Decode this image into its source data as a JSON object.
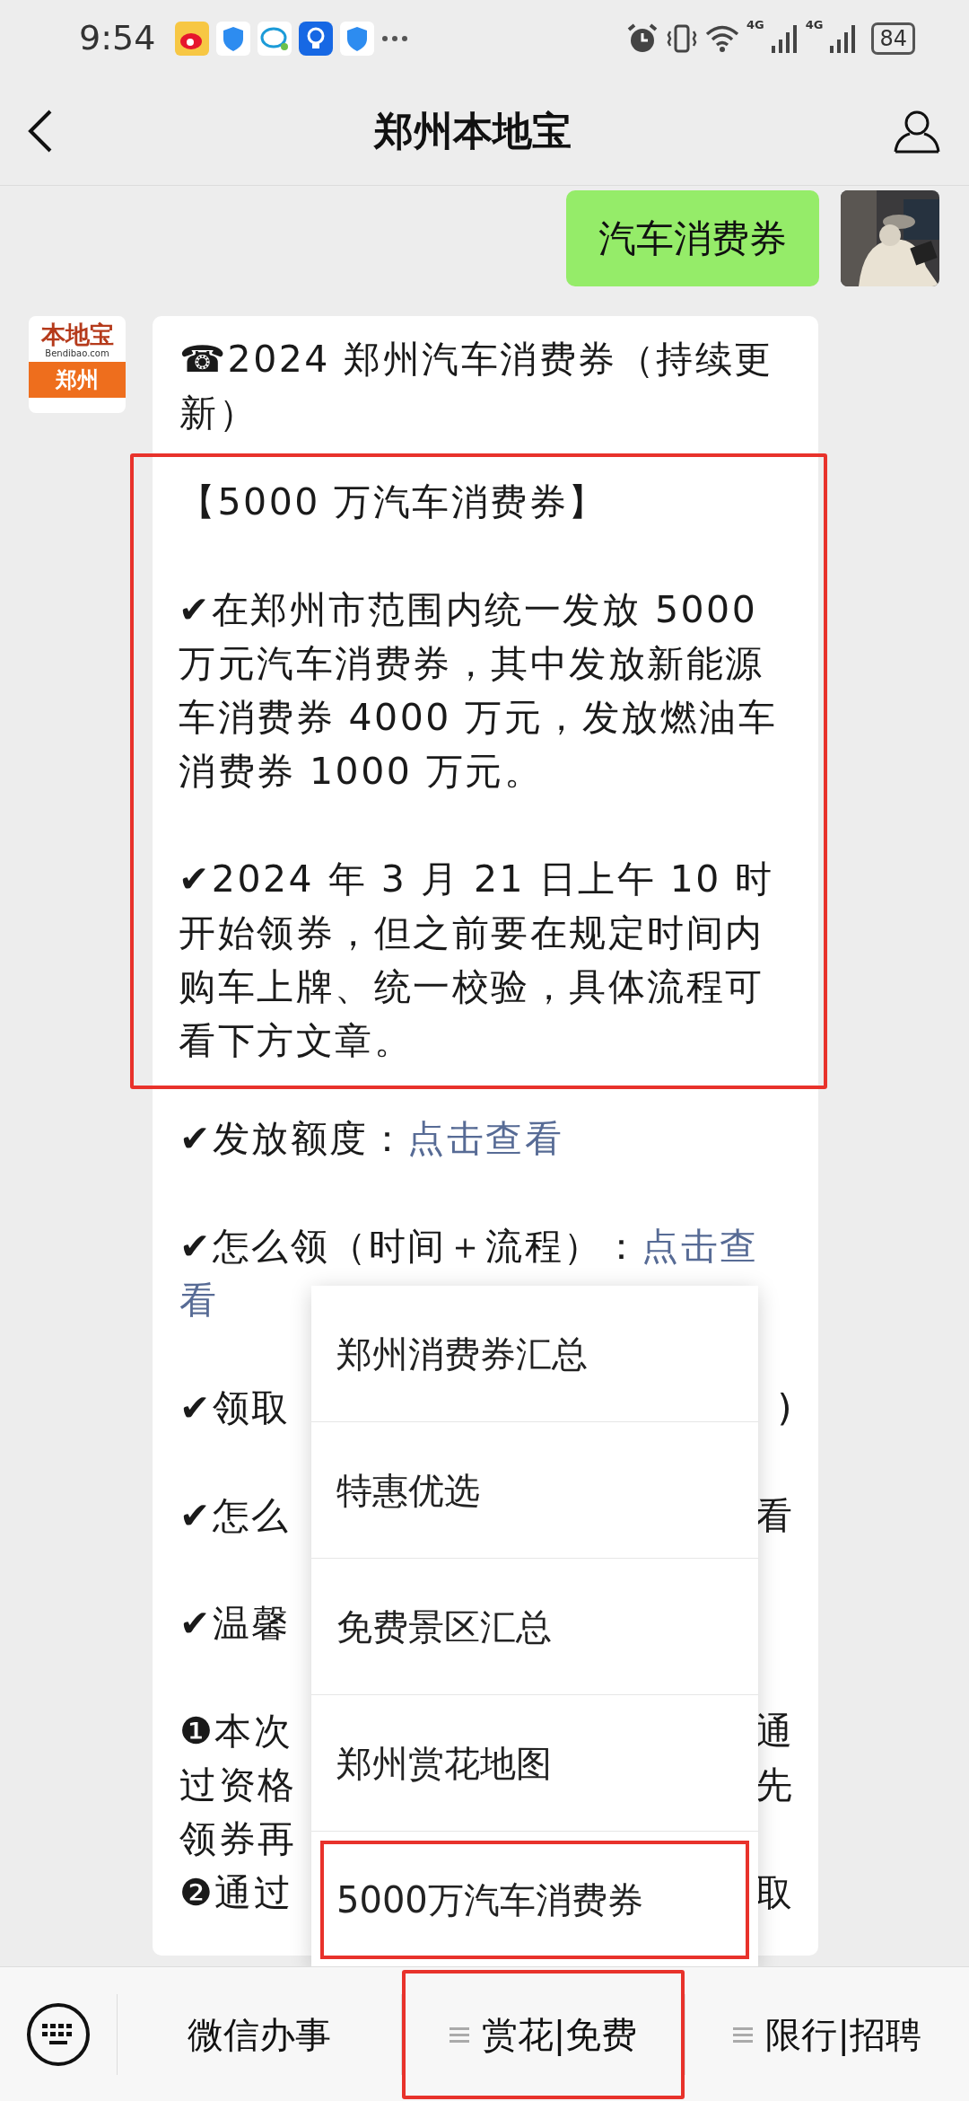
{
  "status_bar": {
    "time": "9:54",
    "network": [
      "4G",
      "4G"
    ],
    "battery": "84"
  },
  "header": {
    "title": "郑州本地宝"
  },
  "sent": {
    "text": "汽车消费券"
  },
  "received": {
    "avatar_lines": [
      "本地宝",
      "Bendibao.com",
      "郑州"
    ],
    "title": "☎2024 郑州汽车消费券（持续更新）",
    "highlight": {
      "framed": true,
      "heading": "【5000 万汽车消费券】",
      "paragraphs": [
        "✔在郑州市范围内统一发放 5000 万元汽车消费券，其中发放新能源车消费券 4000 万元，发放燃油车消费券 1000 万元。",
        "✔2024 年 3 月 21 日上午 10 时开始领券，但之前要在规定时间内购车上牌、统一校验，具体流程可看下方文章。"
      ]
    },
    "items": [
      {
        "kind": "link",
        "text": "✔发放额度：",
        "link": [
          "点击查看"
        ]
      },
      {
        "kind": "link",
        "text": "✔怎么领（时间＋流程）：",
        "link": [
          "点击查",
          "看"
        ]
      },
      {
        "kind": "covered",
        "lines": [
          {
            "left": "✔领取",
            "right": ")"
          }
        ]
      },
      {
        "kind": "covered",
        "lines": [
          {
            "left": "✔怎么",
            "right": "看"
          }
        ]
      },
      {
        "kind": "covered",
        "lines": [
          {
            "left": "✔温馨"
          }
        ]
      },
      {
        "kind": "covered",
        "lines": [
          {
            "left": "❶本次",
            "right": "通"
          },
          {
            "left": "过资格",
            "right": "先"
          },
          {
            "left": "领券再"
          },
          {
            "left": "❷通过",
            "right": "取"
          }
        ]
      }
    ]
  },
  "menu": {
    "items": [
      {
        "label": "郑州消费券汇总",
        "highlighted": false
      },
      {
        "label": "特惠优选",
        "highlighted": false
      },
      {
        "label": "免费景区汇总",
        "highlighted": false
      },
      {
        "label": "郑州赏花地图",
        "highlighted": false
      },
      {
        "label": "5000万汽车消费券",
        "highlighted": true
      }
    ]
  },
  "bottom_bar": {
    "tabs": [
      {
        "label": "微信办事",
        "kind": "plain",
        "highlighted": false
      },
      {
        "label": "赏花|免费",
        "kind": "submenu",
        "highlighted": true
      },
      {
        "label": "限行|招聘",
        "kind": "submenu",
        "highlighted": false
      }
    ]
  }
}
